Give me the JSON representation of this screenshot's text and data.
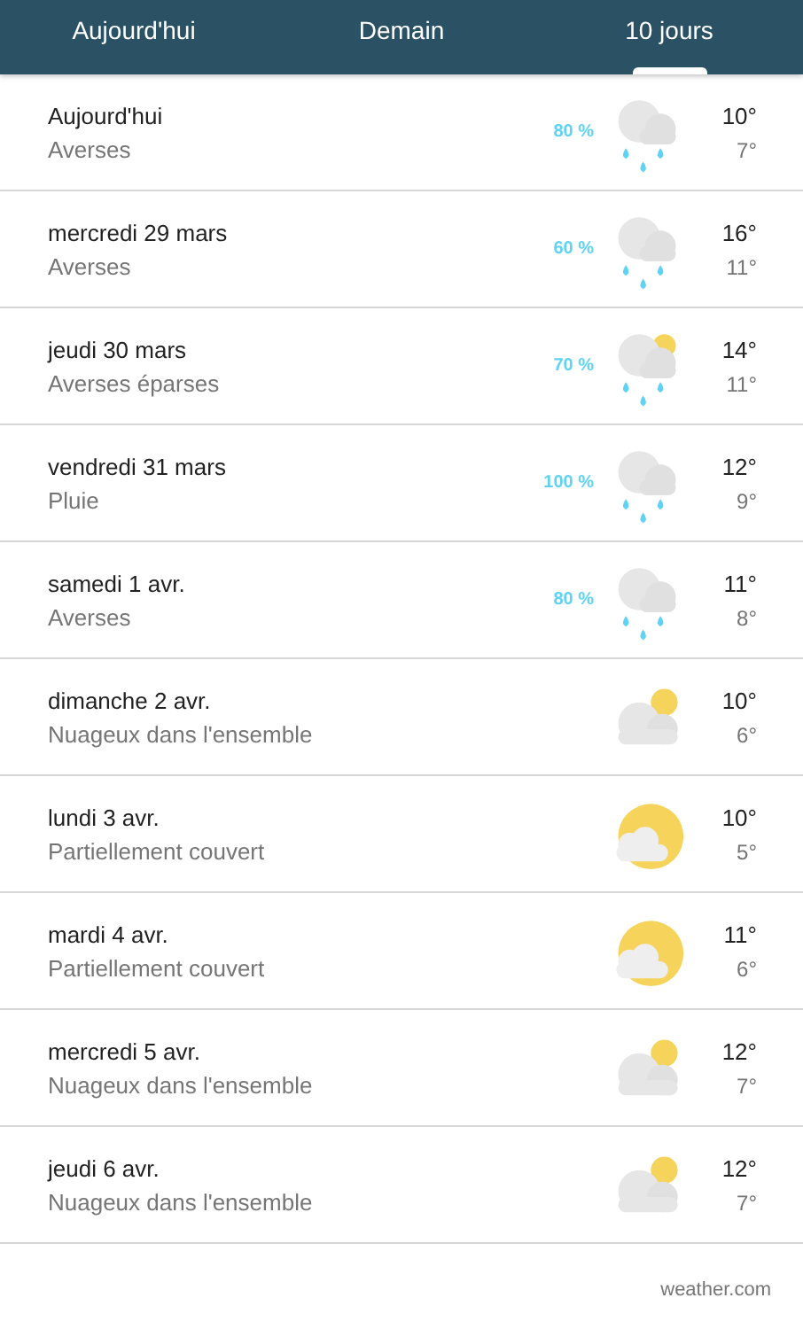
{
  "tabs": [
    {
      "label": "Aujourd'hui",
      "selected": false
    },
    {
      "label": "Demain",
      "selected": false
    },
    {
      "label": "10 jours",
      "selected": true
    }
  ],
  "days": [
    {
      "day": "Aujourd'hui",
      "condition": "Averses",
      "precip": "80 %",
      "kind": "rain",
      "high": "10°",
      "low": "7°"
    },
    {
      "day": "mercredi 29 mars",
      "condition": "Averses",
      "precip": "60 %",
      "kind": "rain",
      "high": "16°",
      "low": "11°"
    },
    {
      "day": "jeudi 30 mars",
      "condition": "Averses éparses",
      "precip": "70 %",
      "kind": "sunrain",
      "high": "14°",
      "low": "11°"
    },
    {
      "day": "vendredi 31 mars",
      "condition": "Pluie",
      "precip": "100 %",
      "kind": "rain",
      "high": "12°",
      "low": "9°"
    },
    {
      "day": "samedi 1 avr.",
      "condition": "Averses",
      "precip": "80 %",
      "kind": "rain",
      "high": "11°",
      "low": "8°"
    },
    {
      "day": "dimanche 2 avr.",
      "condition": "Nuageux dans l'ensemble",
      "kind": "cloudy",
      "high": "10°",
      "low": "6°"
    },
    {
      "day": "lundi 3 avr.",
      "condition": "Partiellement couvert",
      "kind": "sunny",
      "high": "10°",
      "low": "5°"
    },
    {
      "day": "mardi 4 avr.",
      "condition": "Partiellement couvert",
      "kind": "sunny",
      "high": "11°",
      "low": "6°"
    },
    {
      "day": "mercredi 5 avr.",
      "condition": "Nuageux dans l'ensemble",
      "kind": "cloudy",
      "high": "12°",
      "low": "7°"
    },
    {
      "day": "jeudi 6 avr.",
      "condition": "Nuageux dans l'ensemble",
      "kind": "cloudy",
      "high": "12°",
      "low": "7°"
    }
  ],
  "source": "weather.com"
}
